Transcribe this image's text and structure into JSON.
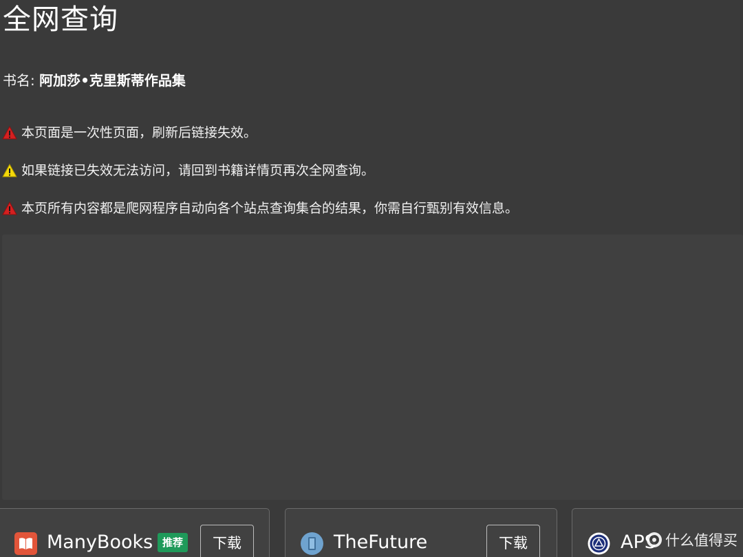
{
  "page": {
    "title": "全网查询"
  },
  "book": {
    "label": "书名:",
    "name": "阿加莎•克里斯蒂作品集"
  },
  "notices": [
    {
      "icon": "warning-red-icon",
      "color": "#d42020",
      "text": "本页面是一次性页面，刷新后链接失效。"
    },
    {
      "icon": "warning-yellow-icon",
      "color": "#f5d90a",
      "text": "如果链接已失效无法访问，请回到书籍详情页再次全网查询。"
    },
    {
      "icon": "warning-red-icon",
      "color": "#d42020",
      "text": "本页所有内容都是爬网程序自动向各个站点查询集合的结果，你需自行甄别有效信息。"
    }
  ],
  "sources": [
    {
      "name": "ManyBooks",
      "icon": "book-icon",
      "badge": "推荐",
      "badge_color": "#1f9a5a",
      "download_label": "下载"
    },
    {
      "name": "TheFuture",
      "icon": "bookmark-icon",
      "download_label": "下载"
    },
    {
      "name": "APS",
      "icon": "emblem-icon"
    }
  ],
  "watermark": {
    "text": "什么值得买"
  }
}
